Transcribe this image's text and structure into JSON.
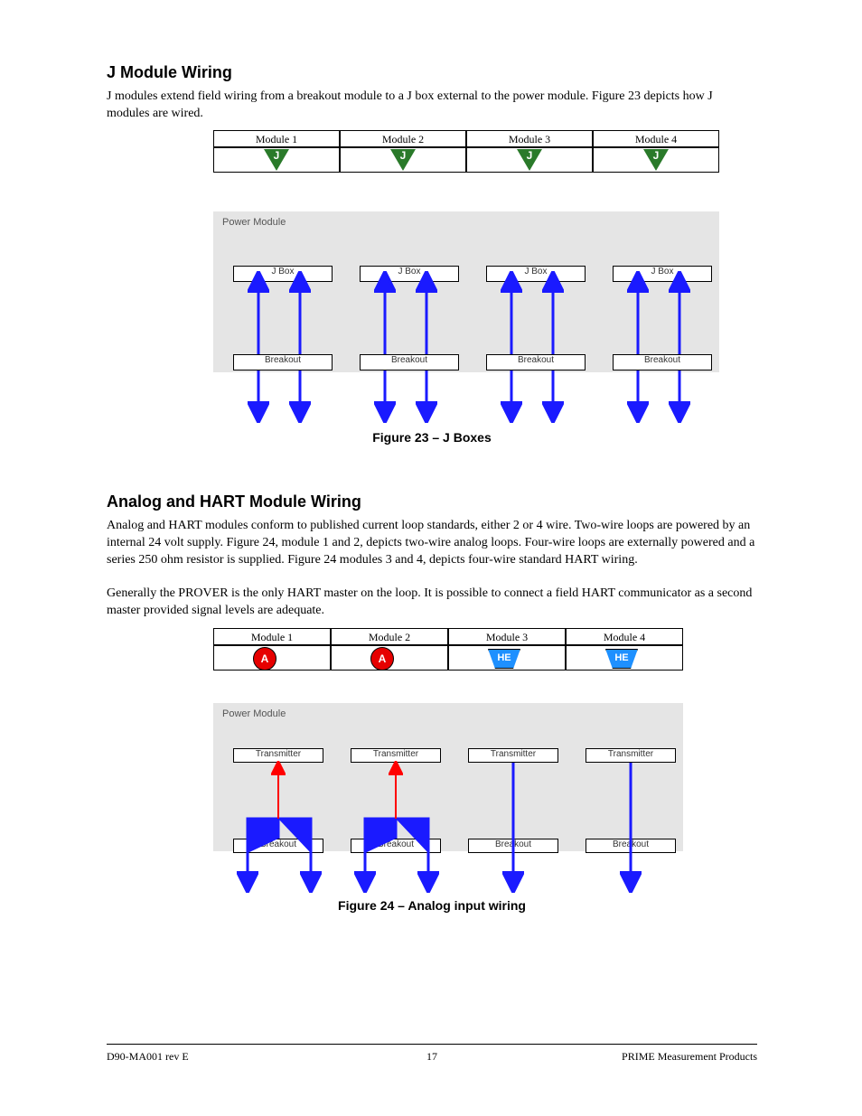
{
  "section1": {
    "title": "J Module Wiring",
    "table_headers": [
      "Module 1",
      "Module 2",
      "Module 3",
      "Module 4"
    ],
    "badge": "J",
    "jbox_label": "J Box",
    "breakout_label": "Breakout",
    "grey_title": "Power Module",
    "para1": "J modules extend field wiring from a breakout module to a J box external to the power module. Figure 23 depicts how J modules are wired.",
    "caption": "Figure 23 – J Boxes"
  },
  "section2": {
    "title": "Analog and HART Module Wiring",
    "table1_headers": [
      "Module 1",
      "Module 2",
      "Module 3",
      "Module 4"
    ],
    "a_badge": "A",
    "he_badge": "HE",
    "transmitter_label": "Transmitter",
    "breakout_label": "Breakout",
    "grey_title": "Power Module",
    "para1": "Analog and HART modules conform to published current loop standards, either 2 or 4 wire. Two-wire loops are powered by an internal 24 volt supply. Figure 24, module 1 and 2, depicts two-wire analog loops. Four-wire loops are externally powered and a series 250 ohm resistor is supplied. Figure 24 modules 3 and 4, depicts four-wire standard HART wiring.",
    "para2": "Generally the PROVER is the only HART master on the loop. It is possible to connect a field HART communicator as a second master provided signal levels are adequate.",
    "caption": "Figure 24 – Analog input wiring"
  },
  "footer": {
    "left": "D90-MA001 rev E",
    "center": "17",
    "right": "PRIME Measurement Products"
  }
}
